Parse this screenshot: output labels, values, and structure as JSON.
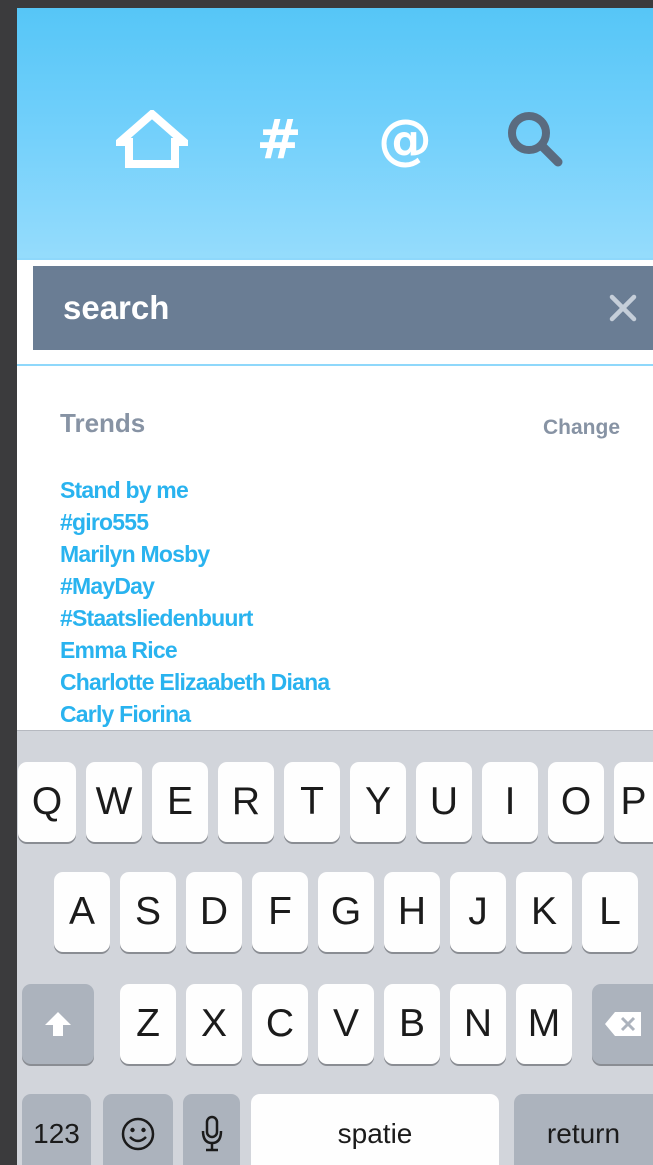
{
  "nav": {
    "home_icon": "home-icon",
    "hashtag_icon": "hashtag-icon",
    "mention_icon": "mention-icon",
    "search_icon": "search-icon",
    "active_icon_color": "#ffffff",
    "inactive_icon_color": "#5a6b7f"
  },
  "search": {
    "placeholder": "search",
    "clear_icon": "close-icon"
  },
  "trends": {
    "title": "Trends",
    "change_label": "Change",
    "items": [
      "Stand by me",
      "#giro555",
      "Marilyn Mosby",
      "#MayDay",
      "#Staatsliedenbuurt",
      "Emma Rice",
      "Charlotte Elizaabeth Diana",
      "Carly Fiorina"
    ]
  },
  "keyboard": {
    "row1": [
      "Q",
      "W",
      "E",
      "R",
      "T",
      "Y",
      "U",
      "I",
      "O",
      "P"
    ],
    "row2": [
      "A",
      "S",
      "D",
      "F",
      "G",
      "H",
      "J",
      "K",
      "L"
    ],
    "row3": [
      "Z",
      "X",
      "C",
      "V",
      "B",
      "N",
      "M"
    ],
    "shift_icon": "shift-icon",
    "delete_icon": "backspace-icon",
    "numbers_label": "123",
    "emoji_icon": "emoji-icon",
    "mic_icon": "microphone-icon",
    "space_label": "spatie",
    "return_label": "return"
  },
  "colors": {
    "header_top": "#56c6f7",
    "header_bottom": "#95dcfc",
    "search_bg": "#6a7d94",
    "trend_link": "#29b3ef",
    "muted_text": "#8793a4",
    "keyboard_bg": "#d2d5db"
  }
}
